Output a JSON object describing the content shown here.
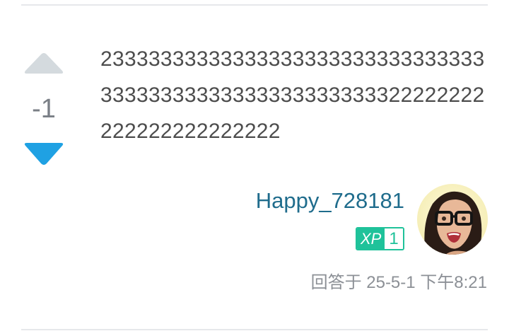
{
  "answer": {
    "vote_score": "-1",
    "text": "2333333333333333333333333333333333333333333333333333333322222222222222222222222",
    "author": {
      "name": "Happy_728181",
      "xp_label": "XP",
      "xp_level": "1"
    },
    "meta": "回答于 25-5-1 下午8:21"
  },
  "colors": {
    "upvote_inactive": "#d4dade",
    "downvote_active": "#1fa1e3",
    "author_link": "#1f6c8c",
    "xp_badge": "#1fc29a",
    "text": "#4d4d4d",
    "meta": "#8c9096",
    "divider": "#e6e8eb"
  },
  "icons": {
    "upvote": "triangle-up-icon",
    "downvote": "triangle-down-icon"
  }
}
